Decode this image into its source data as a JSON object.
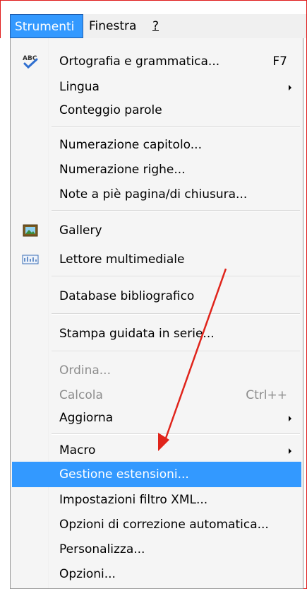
{
  "menubar": {
    "items": [
      {
        "label": "Strumenti"
      },
      {
        "label": "Finestra"
      },
      {
        "label": "?"
      }
    ]
  },
  "menu": {
    "items": [
      {
        "label": "Ortografia e grammatica...",
        "shortcut": "F7",
        "icon": "spellcheck-icon"
      },
      {
        "label": "Lingua",
        "submenu": true
      },
      {
        "label": "Conteggio parole"
      },
      {
        "label": "Numerazione capitolo..."
      },
      {
        "label": "Numerazione righe..."
      },
      {
        "label": "Note a piè pagina/di chiusura..."
      },
      {
        "label": "Gallery",
        "icon": "gallery-icon"
      },
      {
        "label": "Lettore multimediale",
        "icon": "media-player-icon"
      },
      {
        "label": "Database bibliografico"
      },
      {
        "label": "Stampa guidata in serie..."
      },
      {
        "label": "Ordina...",
        "disabled": true
      },
      {
        "label": "Calcola",
        "shortcut": "Ctrl++",
        "disabled": true
      },
      {
        "label": "Aggiorna",
        "submenu": true
      },
      {
        "label": "Macro",
        "submenu": true
      },
      {
        "label": "Gestione estensioni...",
        "highlighted": true
      },
      {
        "label": "Impostazioni filtro XML..."
      },
      {
        "label": "Opzioni di correzione automatica..."
      },
      {
        "label": "Personalizza..."
      },
      {
        "label": "Opzioni..."
      }
    ]
  },
  "annotation": {
    "color": "#e0241b"
  }
}
